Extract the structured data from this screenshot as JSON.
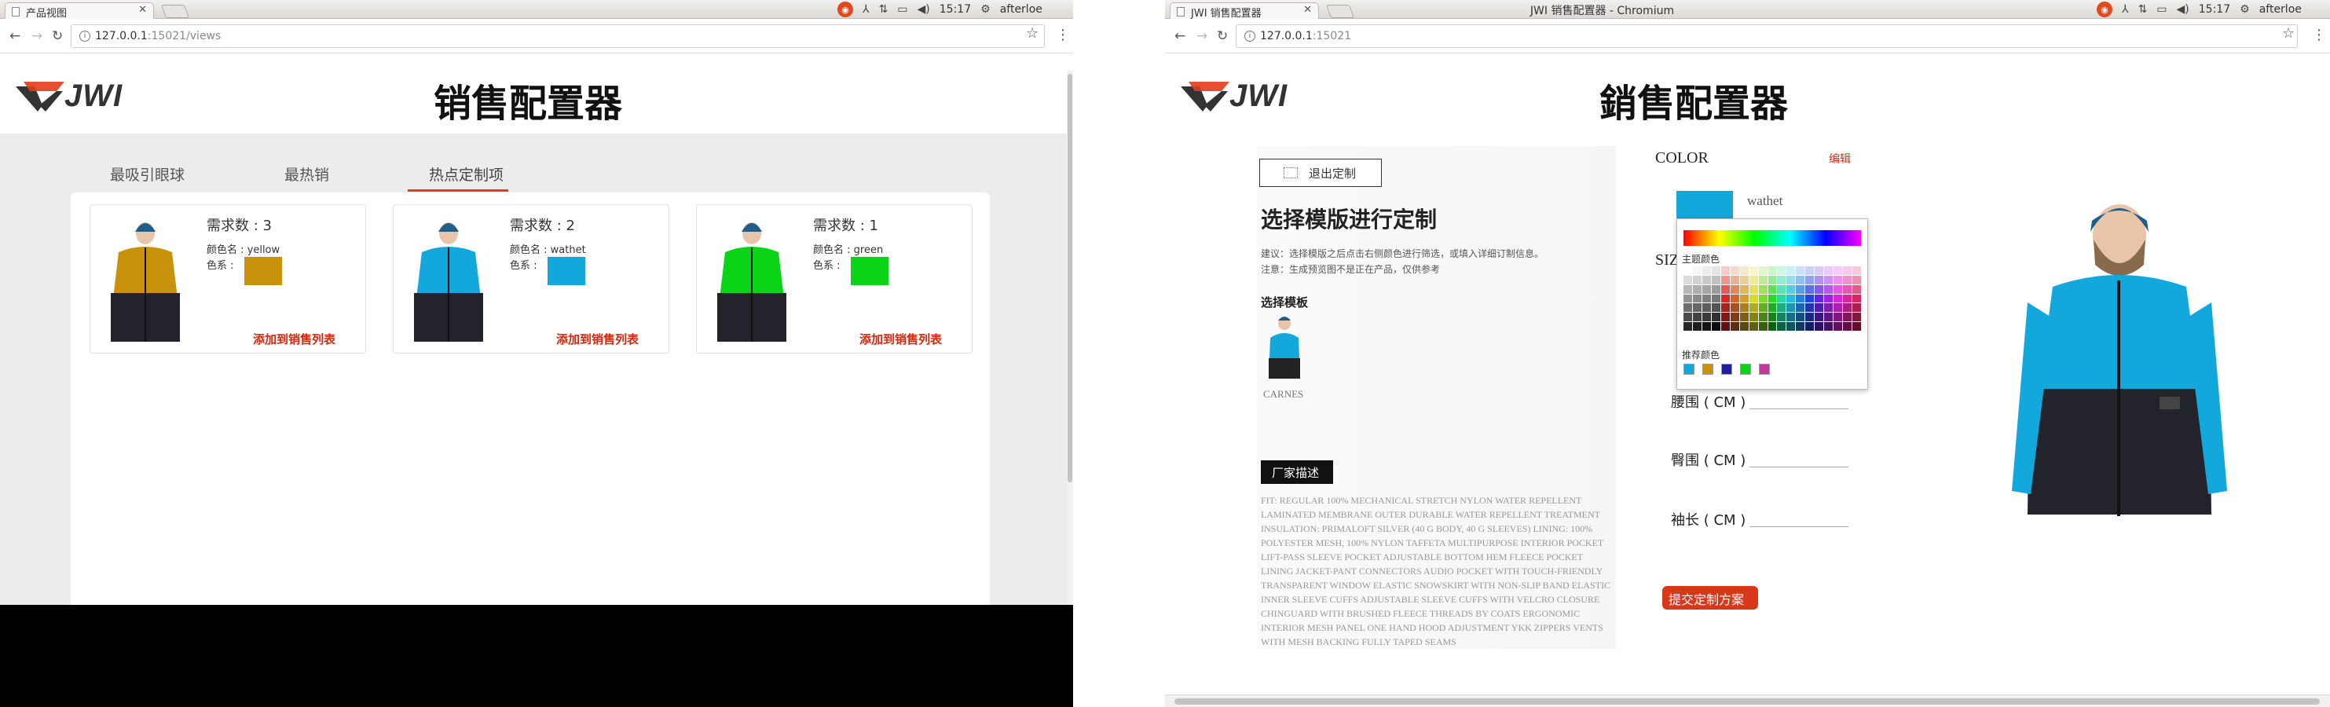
{
  "left_window": {
    "tab_title": "产品视图",
    "url_host": "127.0.0.1",
    "url_rest": ":15021/views",
    "system": {
      "user": "afterloe",
      "time": "15:17"
    },
    "logo": "JWI",
    "page_title": "销售配置器",
    "nav_tabs": [
      {
        "label": "最吸引眼球"
      },
      {
        "label": "最热销"
      },
      {
        "label": "热点定制项"
      }
    ],
    "cards": [
      {
        "need": "需求数 : 3",
        "color_name": "颜色名 : yellow",
        "color_system_label": "色系 :",
        "swatch": "#c8930a",
        "add_label": "添加到销售列表"
      },
      {
        "need": "需求数 : 2",
        "color_name": "颜色名 : wathet",
        "color_system_label": "色系 :",
        "swatch": "#12a8db",
        "add_label": "添加到销售列表"
      },
      {
        "need": "需求数 : 1",
        "color_name": "颜色名 : green",
        "color_system_label": "色系 :",
        "swatch": "#09d417",
        "add_label": "添加到销售列表"
      }
    ]
  },
  "right_window": {
    "window_title": "JWI 销售配置器 - Chromium",
    "tab_title": "JWI 销售配置器",
    "url_host": "127.0.0.1",
    "url_rest": ":15021",
    "system": {
      "user": "afterloe",
      "time": "15:17"
    },
    "logo": "JWI",
    "page_title": "銷售配置器",
    "exit_label": "退出定制",
    "heading": "选择模版进行定制",
    "tip1": "建议：选择模版之后点击右侧颜色进行筛选，或填入详细订制信息。",
    "tip2": "注意：生成预览图不是正在产品，仅供参考",
    "template_label": "选择模板",
    "template_name": "CARNES",
    "mfr_label": "厂家描述",
    "mfr_text": "FIT: REGULAR 100% MECHANICAL STRETCH NYLON WATER REPELLENT LAMINATED MEMBRANE OUTER DURABLE WATER REPELLENT TREATMENT INSULATION: PRIMALOFT SILVER (40 G BODY, 40 G SLEEVES) LINING: 100% POLYESTER MESH, 100% NYLON TAFFETA MULTIPURPOSE INTERIOR POCKET LIFT-PASS SLEEVE POCKET ADJUSTABLE BOTTOM HEM FLEECE POCKET LINING JACKET-PANT CONNECTORS AUDIO POCKET WITH TOUCH-FRIENDLY TRANSPARENT WINDOW ELASTIC SNOWSKIRT WITH NON-SLIP BAND ELASTIC INNER SLEEVE CUFFS ADJUSTABLE SLEEVE CUFFS WITH VELCRO CLOSURE CHINGUARD WITH BRUSHED FLEECE THREADS BY COATS ERGONOMIC INTERIOR MESH PANEL ONE HAND HOOD ADJUSTMENT YKK ZIPPERS VENTS WITH MESH BACKING FULLY TAPED SEAMS",
    "color_title": "COLOR",
    "edit_label": "编辑",
    "current_color": {
      "name": "wathet",
      "hex": "#12a8db"
    },
    "size_title": "SIZ",
    "picker": {
      "theme_label": "主题颜色",
      "recommend_label": "推荐颜色",
      "recommended": [
        "#12a8db",
        "#c8930a",
        "#1e1ea0",
        "#09d417",
        "#c03a9c"
      ]
    },
    "measurements": [
      {
        "label": "腰围 ( CM )"
      },
      {
        "label": "臀围 ( CM )"
      },
      {
        "label": "袖长 ( CM )"
      }
    ],
    "submit_label": "提交定制方案"
  }
}
